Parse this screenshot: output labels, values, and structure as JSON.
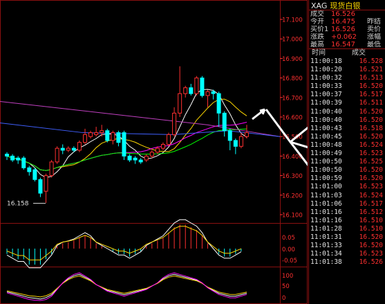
{
  "header": {
    "symbol": "XAG",
    "name": "现货白银"
  },
  "quote": [
    {
      "label": "成交",
      "value": "16.526",
      "color": "up",
      "label2": ""
    },
    {
      "label": "今开",
      "value": "16.475",
      "color": "up",
      "label2": "昨结"
    },
    {
      "label": "买价1",
      "value": "16.526",
      "color": "up",
      "label2": "卖价"
    },
    {
      "label": "涨跌",
      "value": "+0.062",
      "color": "up",
      "label2": "涨幅"
    },
    {
      "label": "最高",
      "value": "16.547",
      "color": "up",
      "label2": "最低"
    }
  ],
  "ticks_header": {
    "time": "时间",
    "price": "成交"
  },
  "ticks": [
    {
      "time": "11:00:18",
      "price": "16.528"
    },
    {
      "time": "11:00:20",
      "price": "16.521"
    },
    {
      "time": "11:00:32",
      "price": "16.513"
    },
    {
      "time": "11:00:33",
      "price": "16.520"
    },
    {
      "time": "11:00:37",
      "price": "16.517"
    },
    {
      "time": "11:00:39",
      "price": "16.511"
    },
    {
      "time": "11:00:40",
      "price": "16.520"
    },
    {
      "time": "11:00:40",
      "price": "16.520"
    },
    {
      "time": "11:00:43",
      "price": "16.518"
    },
    {
      "time": "11:00:45",
      "price": "16.520"
    },
    {
      "time": "11:00:48",
      "price": "16.524"
    },
    {
      "time": "11:00:49",
      "price": "16.523"
    },
    {
      "time": "11:00:50",
      "price": "16.525"
    },
    {
      "time": "11:00:50",
      "price": "16.520"
    },
    {
      "time": "11:00:59",
      "price": "16.520"
    },
    {
      "time": "11:01:00",
      "price": "16.523"
    },
    {
      "time": "11:01:03",
      "price": "16.524"
    },
    {
      "time": "11:01:06",
      "price": "16.517"
    },
    {
      "time": "11:01:16",
      "price": "16.512"
    },
    {
      "time": "11:01:16",
      "price": "16.510"
    },
    {
      "time": "11:01:28",
      "price": "16.510"
    },
    {
      "time": "11:01:31",
      "price": "16.520"
    },
    {
      "time": "11:01:33",
      "price": "16.520"
    },
    {
      "time": "11:01:34",
      "price": "16.523"
    },
    {
      "time": "11:01:38",
      "price": "16.526"
    }
  ],
  "price_axis": [
    "17.100",
    "17.000",
    "16.900",
    "16.800",
    "16.700",
    "16.600",
    "16.500",
    "16.400",
    "16.300",
    "16.200",
    "16.100"
  ],
  "min_label": "16.158",
  "macd_axis": [
    "0.05",
    "0.00",
    "-0.05"
  ],
  "kdj_axis": [
    "100",
    "50",
    "0"
  ],
  "colors": {
    "up": "#ff3030",
    "down": "#00ffff",
    "grid": "#8a1010",
    "axis": "#ff3030"
  },
  "chart_data": {
    "type": "candlestick",
    "ylim": [
      16.1,
      17.1
    ],
    "candles": [
      [
        16.41,
        16.4,
        16.42,
        16.38
      ],
      [
        16.4,
        16.38,
        16.41,
        16.37
      ],
      [
        16.39,
        16.38,
        16.4,
        16.36
      ],
      [
        16.39,
        16.34,
        16.4,
        16.33
      ],
      [
        16.34,
        16.32,
        16.35,
        16.3
      ],
      [
        16.33,
        16.28,
        16.34,
        16.27
      ],
      [
        16.28,
        16.21,
        16.29,
        16.19
      ],
      [
        16.22,
        16.3,
        16.31,
        16.16
      ],
      [
        16.3,
        16.37,
        16.38,
        16.29
      ],
      [
        16.37,
        16.44,
        16.45,
        16.36
      ],
      [
        16.44,
        16.43,
        16.46,
        16.41
      ],
      [
        16.43,
        16.44,
        16.45,
        16.42
      ],
      [
        16.44,
        16.43,
        16.45,
        16.42
      ],
      [
        16.43,
        16.47,
        16.48,
        16.42
      ],
      [
        16.47,
        16.51,
        16.54,
        16.46
      ],
      [
        16.5,
        16.52,
        16.53,
        16.49
      ],
      [
        16.51,
        16.52,
        16.55,
        16.5
      ],
      [
        16.52,
        16.53,
        16.56,
        16.5
      ],
      [
        16.53,
        16.48,
        16.54,
        16.47
      ],
      [
        16.48,
        16.52,
        16.53,
        16.46
      ],
      [
        16.52,
        16.47,
        16.53,
        16.45
      ],
      [
        16.52,
        16.4,
        16.53,
        16.38
      ],
      [
        16.4,
        16.38,
        16.41,
        16.37
      ],
      [
        16.39,
        16.38,
        16.4,
        16.36
      ],
      [
        16.38,
        16.37,
        16.39,
        16.36
      ],
      [
        16.38,
        16.4,
        16.41,
        16.37
      ],
      [
        16.4,
        16.42,
        16.43,
        16.39
      ],
      [
        16.42,
        16.44,
        16.45,
        16.41
      ],
      [
        16.44,
        16.46,
        16.47,
        16.43
      ],
      [
        16.46,
        16.51,
        16.52,
        16.45
      ],
      [
        16.51,
        16.62,
        16.65,
        16.5
      ],
      [
        16.62,
        16.72,
        16.86,
        16.6
      ],
      [
        16.72,
        16.75,
        16.76,
        16.7
      ],
      [
        16.75,
        16.72,
        16.77,
        16.71
      ],
      [
        16.72,
        16.8,
        16.81,
        16.71
      ],
      [
        16.8,
        16.71,
        16.81,
        16.7
      ],
      [
        16.71,
        16.73,
        16.74,
        16.65
      ],
      [
        16.73,
        16.72,
        16.74,
        16.69
      ],
      [
        16.72,
        16.62,
        16.73,
        16.55
      ],
      [
        16.62,
        16.53,
        16.63,
        16.5
      ],
      [
        16.53,
        16.48,
        16.54,
        16.43
      ],
      [
        16.48,
        16.45,
        16.49,
        16.41
      ],
      [
        16.45,
        16.5,
        16.52,
        16.44
      ],
      [
        16.5,
        16.52,
        16.56,
        16.49
      ]
    ],
    "macd_hist": [
      -0.01,
      -0.015,
      -0.02,
      -0.02,
      -0.03,
      -0.03,
      -0.03,
      -0.02,
      -0.01,
      0.005,
      0.01,
      0.012,
      0.015,
      0.02,
      0.025,
      0.02,
      0.01,
      0.005,
      0.0,
      -0.005,
      -0.01,
      -0.01,
      -0.015,
      -0.01,
      -0.005,
      0.005,
      0.01,
      0.015,
      0.02,
      0.03,
      0.04,
      0.045,
      0.045,
      0.04,
      0.035,
      0.025,
      0.01,
      0.0,
      -0.01,
      -0.015,
      -0.015,
      -0.01,
      -0.005
    ],
    "kdj_k": [
      30,
      25,
      20,
      15,
      10,
      8,
      5,
      10,
      20,
      40,
      60,
      75,
      85,
      90,
      80,
      70,
      55,
      45,
      35,
      30,
      25,
      20,
      25,
      30,
      35,
      40,
      50,
      60,
      75,
      85,
      90,
      85,
      80,
      75,
      70,
      60,
      45,
      35,
      25,
      20,
      15,
      15,
      20,
      25
    ]
  }
}
